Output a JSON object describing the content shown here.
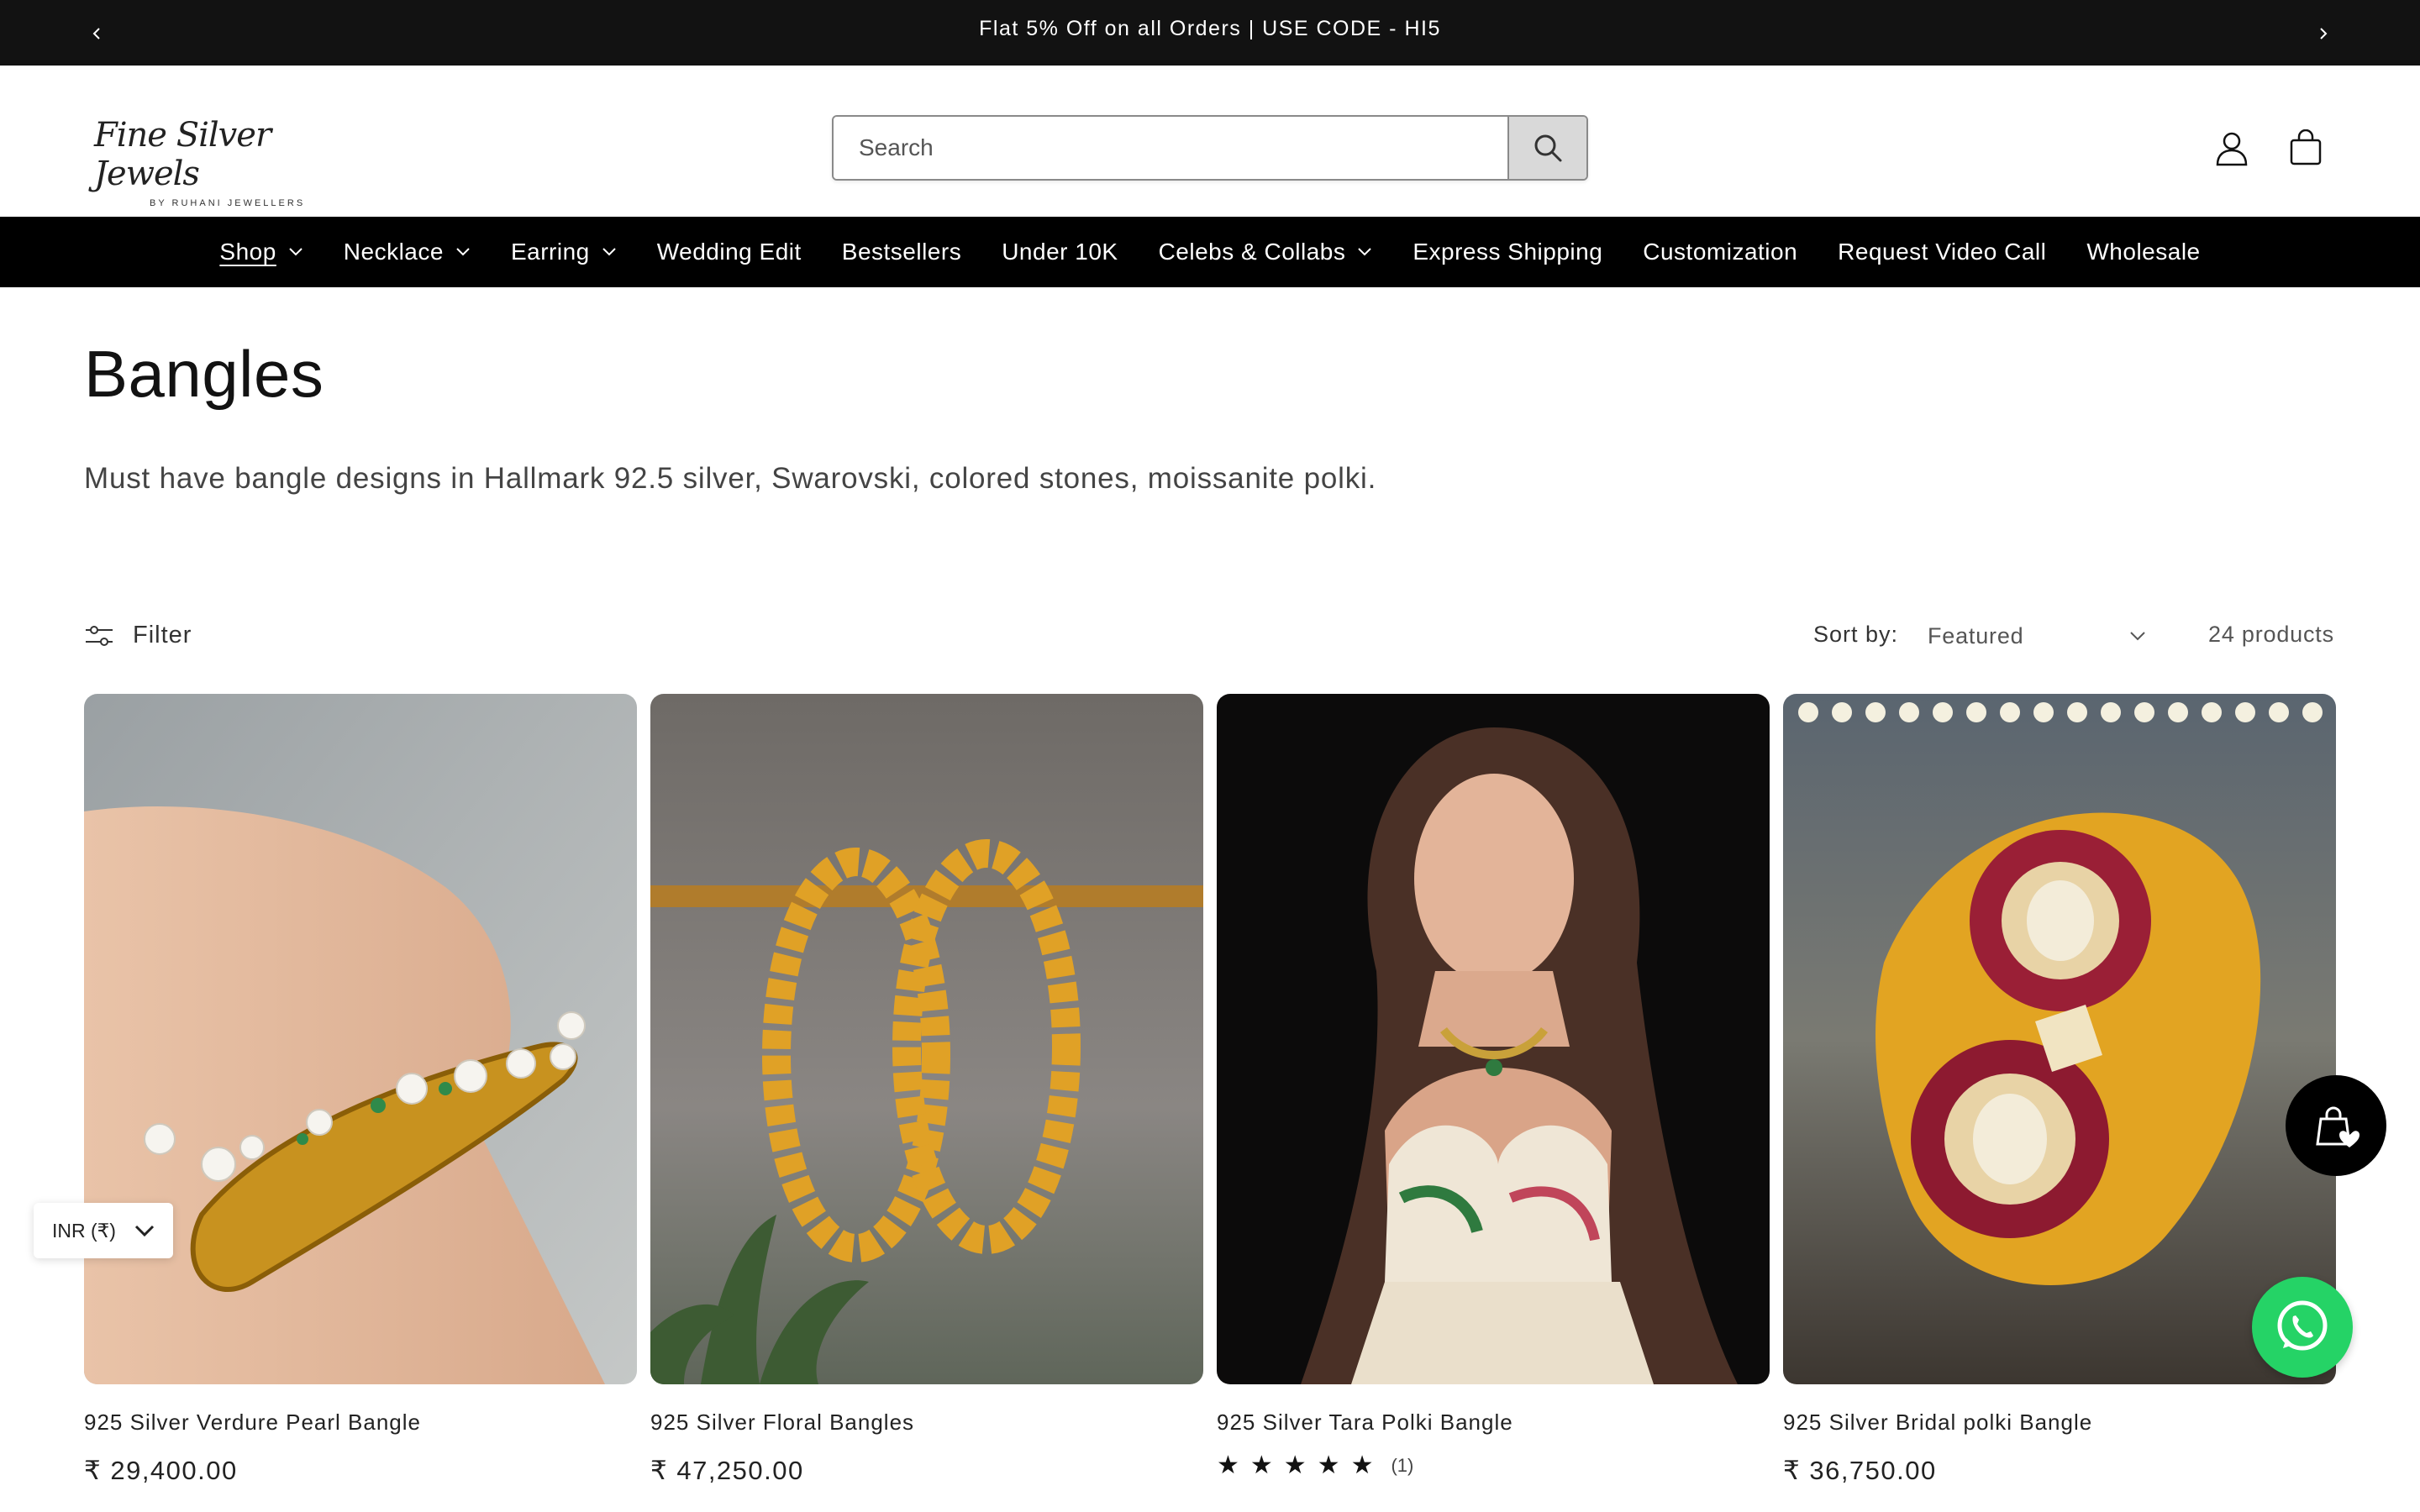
{
  "announcement": {
    "message": "Flat 5% Off on all Orders | USE CODE - HI5",
    "prev_icon": "chevron-left-icon",
    "next_icon": "chevron-right-icon"
  },
  "header": {
    "logo_script": "Fine Silver Jewels",
    "logo_sub": "BY RUHANI JEWELLERS",
    "search_placeholder": "Search",
    "search_icon": "search-icon",
    "account_icon": "user-icon",
    "cart_icon": "bag-icon"
  },
  "nav": {
    "items": [
      {
        "label": "Shop",
        "dropdown": true,
        "active": true
      },
      {
        "label": "Necklace",
        "dropdown": true
      },
      {
        "label": "Earring",
        "dropdown": true
      },
      {
        "label": "Wedding Edit",
        "dropdown": false
      },
      {
        "label": "Bestsellers",
        "dropdown": false
      },
      {
        "label": "Under 10K",
        "dropdown": false
      },
      {
        "label": "Celebs & Collabs",
        "dropdown": true
      },
      {
        "label": "Express Shipping",
        "dropdown": false
      },
      {
        "label": "Customization",
        "dropdown": false
      },
      {
        "label": "Request Video Call",
        "dropdown": false
      },
      {
        "label": "Wholesale",
        "dropdown": false
      }
    ]
  },
  "collection": {
    "title": "Bangles",
    "description": "Must have bangle designs in Hallmark 92.5 silver, Swarovski, colored stones, moissanite polki."
  },
  "toolbar": {
    "filter_label": "Filter",
    "sort_label": "Sort by:",
    "sort_value": "Featured",
    "product_count": "24 products"
  },
  "products": [
    {
      "name": "925 Silver Verdure Pearl Bangle",
      "price": "₹ 29,400.00"
    },
    {
      "name": "925 Silver Floral Bangles",
      "price": "₹ 47,250.00"
    },
    {
      "name": "925 Silver Tara Polki Bangle",
      "stars": "★★★★★",
      "reviews": "(1)"
    },
    {
      "name": "925 Silver Bridal polki Bangle",
      "price": "₹ 36,750.00"
    }
  ],
  "widgets": {
    "currency": "INR (₹)",
    "wishlist_icon": "wishlist-bag-icon",
    "whatsapp_icon": "whatsapp-icon"
  },
  "colors": {
    "bar_bg": "#121212",
    "nav_bg": "#000000",
    "whatsapp": "#25d366"
  }
}
